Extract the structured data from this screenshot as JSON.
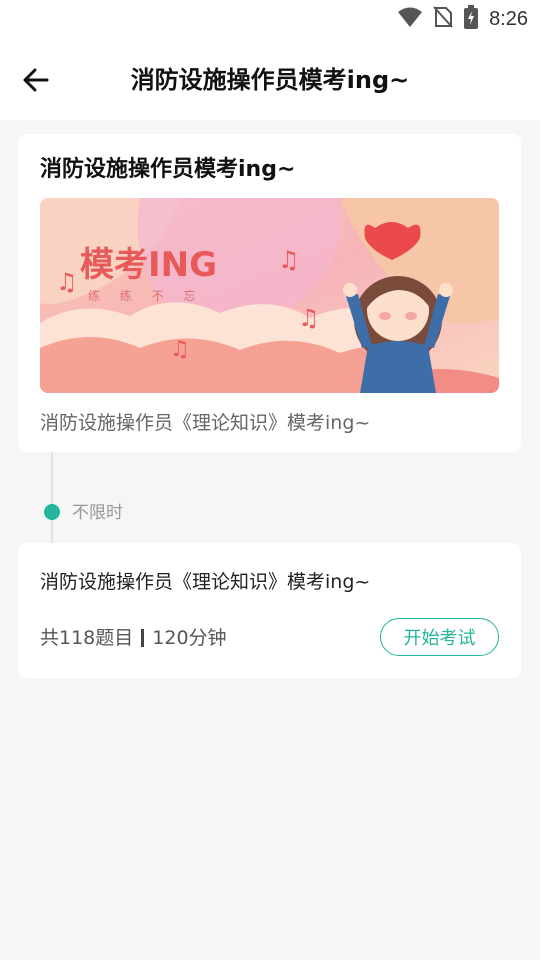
{
  "status_bar": {
    "time": "8:26"
  },
  "header": {
    "title": "消防设施操作员模考ing~"
  },
  "exam_card": {
    "title": "消防设施操作员模考ing~",
    "banner": {
      "headline": "模考ING",
      "subline": "练 练 不 忘"
    },
    "description": "消防设施操作员《理论知识》模考ing~"
  },
  "timeline": {
    "label": "不限时"
  },
  "exam_item": {
    "title": "消防设施操作员《理论知识》模考ing~",
    "question_count": "共118题目",
    "duration": "120分钟",
    "start_label": "开始考试"
  },
  "colors": {
    "accent": "#25b59a",
    "banner_title": "#e85a5a"
  }
}
